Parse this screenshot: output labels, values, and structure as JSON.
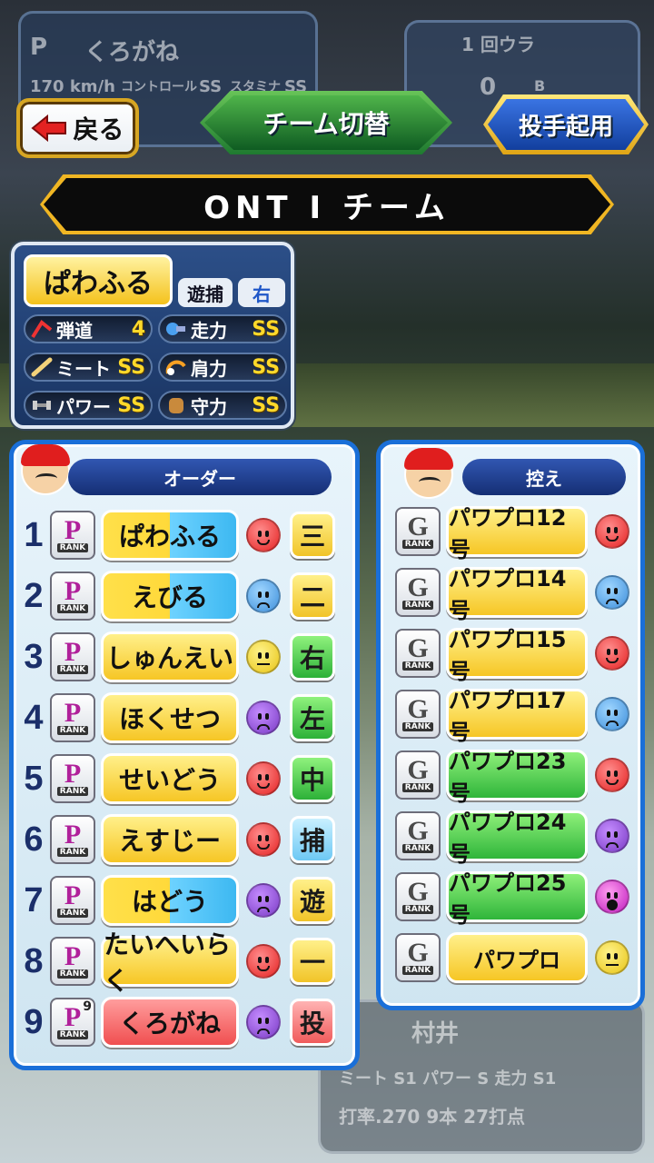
{
  "header": {
    "back_label": "戻る",
    "switch_label": "チーム切替",
    "pitcher_label": "投手起用",
    "team_name": "ONT I チーム"
  },
  "background": {
    "pos_letter": "P",
    "player_name": "くろがね",
    "speed": "170 km/h",
    "control_label": "コントロール",
    "control": "SS",
    "stamina_label": "スタミナ",
    "stamina": "SS",
    "inning": "1 回ウラ",
    "score": "0",
    "outs": "B",
    "bottom_player": "村井",
    "bottom_stats": "ミート S1 パワー S 走力 S1",
    "bottom_avg": "打率.270  9本  27打点"
  },
  "player_card": {
    "name": "ぱわふる",
    "position": "遊捕",
    "hand": "右",
    "stats": [
      {
        "label": "弾道",
        "value": "4",
        "icon": "trajectory-icon"
      },
      {
        "label": "走力",
        "value": "SS",
        "icon": "run-icon"
      },
      {
        "label": "ミート",
        "value": "SS",
        "icon": "bat-icon"
      },
      {
        "label": "肩力",
        "value": "SS",
        "icon": "arm-icon"
      },
      {
        "label": "パワー",
        "value": "SS",
        "icon": "dumbbell-icon"
      },
      {
        "label": "守力",
        "value": "SS",
        "icon": "glove-icon"
      }
    ]
  },
  "order": {
    "title": "オーダー",
    "rows": [
      {
        "num": "1",
        "rank": "P",
        "name": "ぱわふる",
        "pos": "三",
        "face": "happy"
      },
      {
        "num": "2",
        "rank": "P",
        "name": "えびる",
        "pos": "二",
        "face": "sad"
      },
      {
        "num": "3",
        "rank": "P",
        "name": "しゅんえい",
        "pos": "右",
        "face": "neutral"
      },
      {
        "num": "4",
        "rank": "P",
        "name": "ほくせつ",
        "pos": "左",
        "face": "bad"
      },
      {
        "num": "5",
        "rank": "P",
        "name": "せいどう",
        "pos": "中",
        "face": "happy"
      },
      {
        "num": "6",
        "rank": "P",
        "name": "えすじー",
        "pos": "捕",
        "face": "happy"
      },
      {
        "num": "7",
        "rank": "P",
        "name": "はどう",
        "pos": "遊",
        "face": "bad"
      },
      {
        "num": "8",
        "rank": "P",
        "name": "たいへいらく",
        "pos": "一",
        "face": "happy"
      },
      {
        "num": "9",
        "rank": "P",
        "rank_sup": "9",
        "name": "くろがね",
        "pos": "投",
        "face": "bad"
      }
    ]
  },
  "bench": {
    "title": "控え",
    "rows": [
      {
        "rank": "G",
        "name": "パワプロ12号",
        "face": "happy"
      },
      {
        "rank": "G",
        "name": "パワプロ14号",
        "face": "sad"
      },
      {
        "rank": "G",
        "name": "パワプロ15号",
        "face": "happy"
      },
      {
        "rank": "G",
        "name": "パワプロ17号",
        "face": "sad"
      },
      {
        "rank": "G",
        "name": "パワプロ23号",
        "face": "happy"
      },
      {
        "rank": "G",
        "name": "パワプロ24号",
        "face": "bad"
      },
      {
        "rank": "G",
        "name": "パワプロ25号",
        "face": "great"
      },
      {
        "rank": "G",
        "name": "パワプロ",
        "face": "neutral"
      }
    ],
    "rank_text": "RANK"
  }
}
